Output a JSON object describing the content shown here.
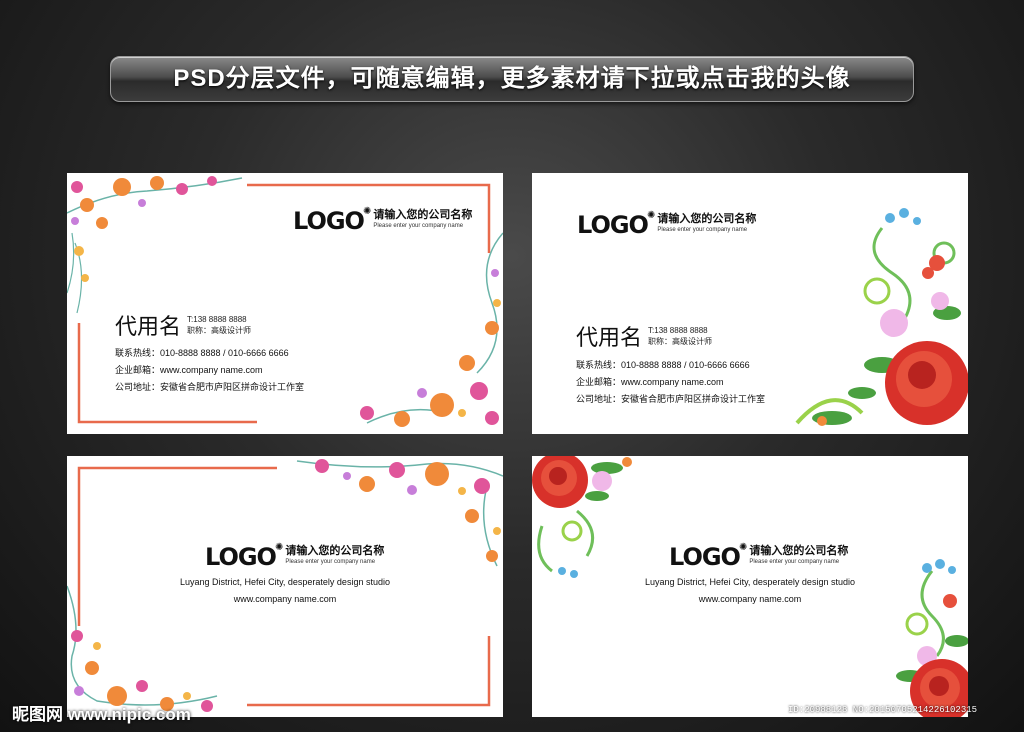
{
  "banner": "PSD分层文件，可随意编辑，更多素材请下拉或点击我的头像",
  "logo": {
    "mark": "LOGO",
    "cn": "请输入您的公司名称",
    "en": "Please enter your company name"
  },
  "person": {
    "name": "代用名",
    "tel": "T:138 8888 8888",
    "title": "职称：高级设计师"
  },
  "contacts": {
    "hotline": "联系热线：010-8888 8888 / 010-6666 6666",
    "email": "企业邮箱：www.company name.com",
    "address": "公司地址：安徽省合肥市庐阳区拼命设计工作室"
  },
  "back": {
    "address_en": "Luyang District, Hefei City, desperately design studio",
    "website": "www.company name.com"
  },
  "watermark": {
    "left": "昵图网 www.nipic.com",
    "right": "ID:20988128 NO:20150705214226102315"
  },
  "colors": {
    "frame": "#e86a4c",
    "rose": "#d8312a"
  }
}
